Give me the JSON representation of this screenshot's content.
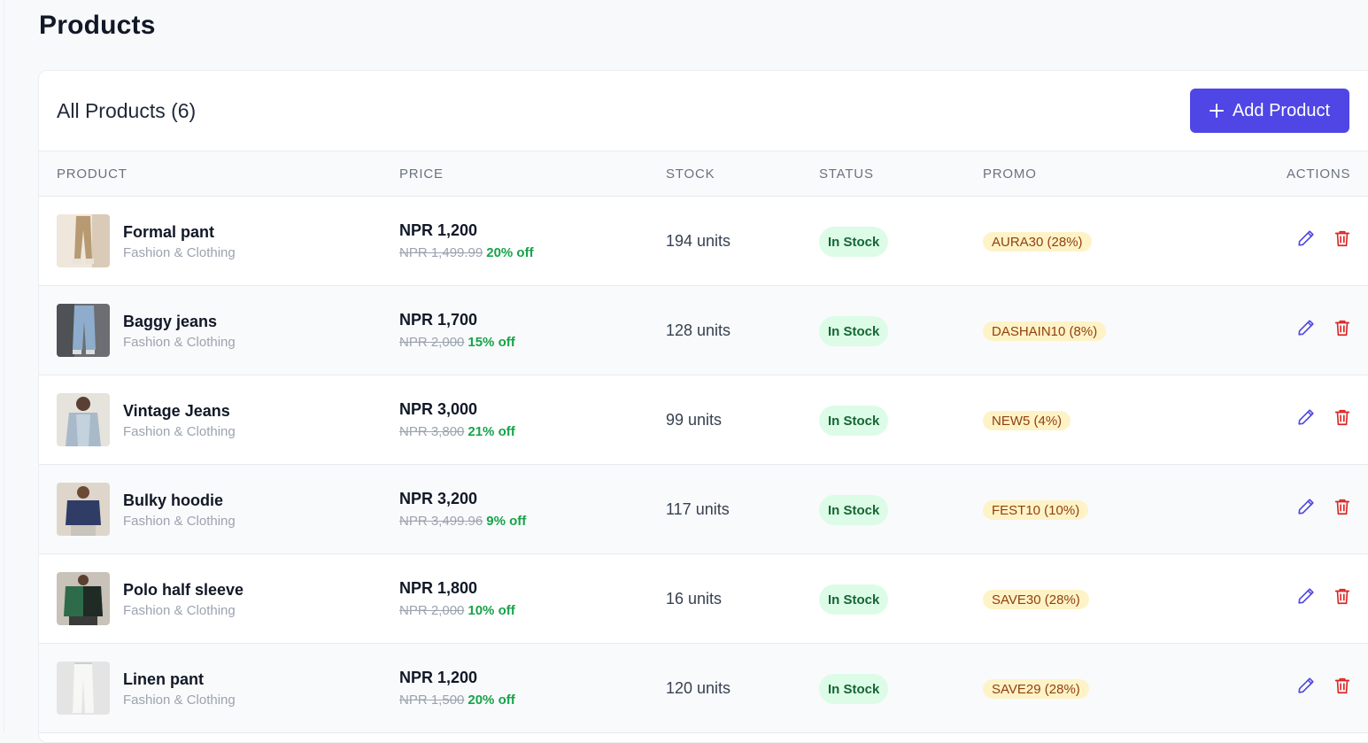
{
  "page": {
    "title": "Products"
  },
  "card": {
    "title": "All Products (6)",
    "add_button_label": "Add Product"
  },
  "table": {
    "headers": {
      "product": "PRODUCT",
      "price": "PRICE",
      "stock": "STOCK",
      "status": "STATUS",
      "promo": "PROMO",
      "actions": "ACTIONS"
    },
    "rows": [
      {
        "name": "Formal pant",
        "category": "Fashion & Clothing",
        "price": "NPR 1,200",
        "old_price": "NPR 1,499.99",
        "discount": "20% off",
        "stock": "194 units",
        "status": "In Stock",
        "promo": "AURA30 (28%)"
      },
      {
        "name": "Baggy jeans",
        "category": "Fashion & Clothing",
        "price": "NPR 1,700",
        "old_price": "NPR 2,000",
        "discount": "15% off",
        "stock": "128 units",
        "status": "In Stock",
        "promo": "DASHAIN10 (8%)"
      },
      {
        "name": "Vintage Jeans",
        "category": "Fashion & Clothing",
        "price": "NPR 3,000",
        "old_price": "NPR 3,800",
        "discount": "21% off",
        "stock": "99 units",
        "status": "In Stock",
        "promo": "NEW5 (4%)"
      },
      {
        "name": "Bulky hoodie",
        "category": "Fashion & Clothing",
        "price": "NPR 3,200",
        "old_price": "NPR 3,499.96",
        "discount": "9% off",
        "stock": "117 units",
        "status": "In Stock",
        "promo": "FEST10 (10%)"
      },
      {
        "name": "Polo half sleeve",
        "category": "Fashion & Clothing",
        "price": "NPR 1,800",
        "old_price": "NPR 2,000",
        "discount": "10% off",
        "stock": "16 units",
        "status": "In Stock",
        "promo": "SAVE30 (28%)"
      },
      {
        "name": "Linen pant",
        "category": "Fashion & Clothing",
        "price": "NPR 1,200",
        "old_price": "NPR 1,500",
        "discount": "20% off",
        "stock": "120 units",
        "status": "In Stock",
        "promo": "SAVE29 (28%)"
      }
    ]
  },
  "icons": {
    "edit": "pencil-icon",
    "delete": "trash-icon",
    "add": "plus-icon"
  },
  "colors": {
    "accent": "#4f46e5",
    "edit_icon": "#4f46e5",
    "delete_icon": "#dc2626",
    "status_bg": "#dcfce7",
    "status_text": "#166534",
    "promo_bg": "#fef3c7",
    "promo_text": "#92400e",
    "discount_text": "#16a34a"
  }
}
